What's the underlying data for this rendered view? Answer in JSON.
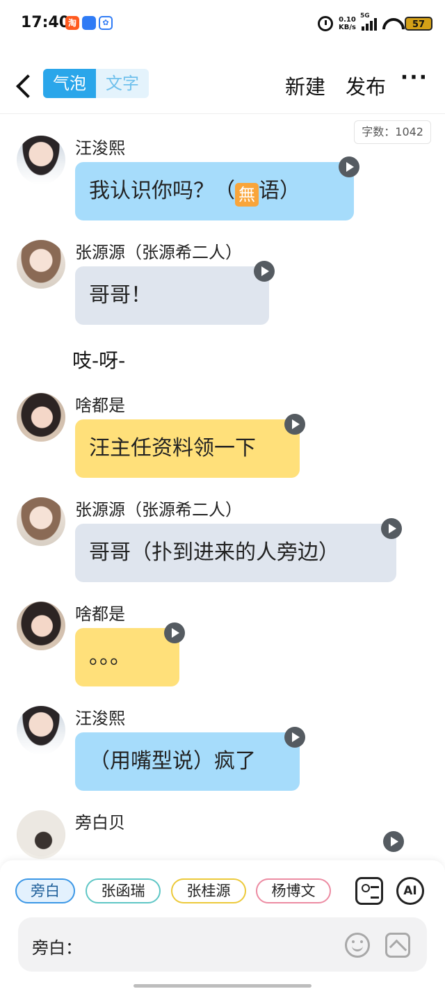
{
  "status_bar": {
    "time": "17:40",
    "apps": [
      "淘",
      "",
      ""
    ],
    "net_speed_value": "0.10",
    "net_speed_unit": "KB/s",
    "network": "5G",
    "battery": "57"
  },
  "header": {
    "tabs": [
      {
        "label": "气泡",
        "active": true
      },
      {
        "label": "文字",
        "active": false
      }
    ],
    "new_label": "新建",
    "publish_label": "发布",
    "more_label": "···"
  },
  "word_count": "字数：1042",
  "messages": [
    {
      "speaker": "汪浚熙",
      "avatar": "avatar-wang",
      "text_before": "我认识你吗？（",
      "emoji": "無",
      "text_after": "语）",
      "color": "#a6dcfb"
    },
    {
      "speaker": "张源源（张源希二人）",
      "avatar": "avatar-zhang",
      "text": "哥哥！",
      "color": "#dfe5ee"
    },
    {
      "narration": "吱-呀-"
    },
    {
      "speaker": "啥都是",
      "avatar": "avatar-sha",
      "text": "汪主任资料领一下",
      "color": "#ffe07a"
    },
    {
      "speaker": "张源源（张源希二人）",
      "avatar": "avatar-zhang",
      "text": "哥哥（扑到进来的人旁边）",
      "color": "#dfe5ee"
    },
    {
      "speaker": "啥都是",
      "avatar": "avatar-sha",
      "text": "。。。",
      "color": "#ffe07a"
    },
    {
      "speaker": "汪浚熙",
      "avatar": "avatar-wang",
      "text": "（用嘴型说）疯了",
      "color": "#a6dcfb"
    },
    {
      "speaker": "旁白贝",
      "avatar": "avatar-pang",
      "text": "",
      "color": "#f4dddd"
    }
  ],
  "characters": [
    "旁白",
    "张函瑞",
    "张桂源",
    "杨博文"
  ],
  "toolbar_icons": [
    "card-icon",
    "ai-icon"
  ],
  "ai_label": "AI",
  "input": {
    "speaker_label": "旁白：",
    "value": ""
  },
  "input_icons": [
    "smile-icon",
    "image-icon"
  ]
}
